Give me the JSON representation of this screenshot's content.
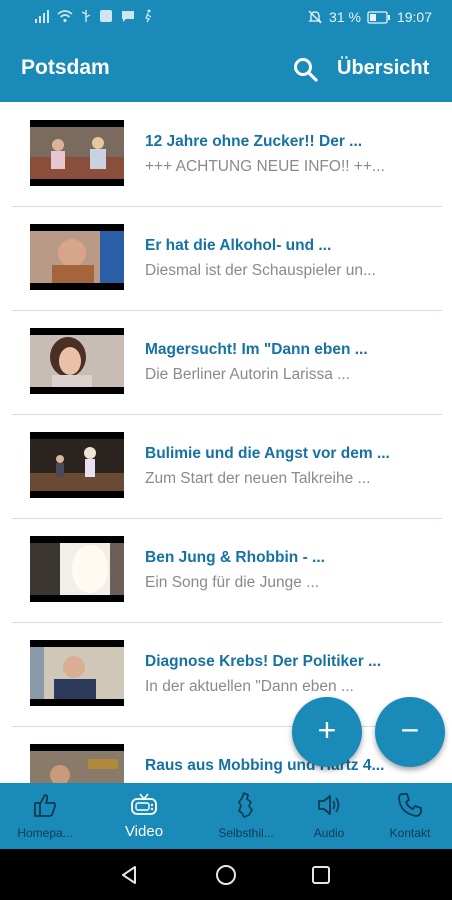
{
  "status": {
    "battery_percent": "31 %",
    "time": "19:07"
  },
  "appbar": {
    "title": "Potsdam",
    "overview_label": "Übersicht"
  },
  "videos": [
    {
      "title": "12 Jahre ohne Zucker!! Der ...",
      "subtitle": "+++ ACHTUNG NEUE INFO!! ++..."
    },
    {
      "title": "Er hat die Alkohol- und ...",
      "subtitle": "Diesmal ist der Schauspieler un..."
    },
    {
      "title": "Magersucht! Im \"Dann eben ...",
      "subtitle": "Die Berliner Autorin Larissa ..."
    },
    {
      "title": "Bulimie und die Angst vor dem ...",
      "subtitle": "Zum Start der neuen Talkreihe ..."
    },
    {
      "title": "Ben Jung & Rhobbin - ...",
      "subtitle": "Ein Song für die Junge ..."
    },
    {
      "title": "Diagnose Krebs! Der Politiker ...",
      "subtitle": "In der aktuellen \"Dann eben ..."
    },
    {
      "title": "Raus aus Mobbing und Hartz 4...",
      "subtitle": ""
    }
  ],
  "fab": {
    "plus": "+",
    "minus": "−"
  },
  "bottom_nav": [
    {
      "label": "Homepa...",
      "icon": "thumbs-up-icon"
    },
    {
      "label": "Video",
      "icon": "tv-icon"
    },
    {
      "label": "Selbsthil...",
      "icon": "map-icon"
    },
    {
      "label": "Audio",
      "icon": "speaker-icon"
    },
    {
      "label": "Kontakt",
      "icon": "phone-icon"
    }
  ],
  "colors": {
    "primary": "#1a8ab9",
    "title_text": "#1672a3",
    "subtitle_text": "#8a8a8a",
    "nav_inactive": "#0d3b55"
  }
}
